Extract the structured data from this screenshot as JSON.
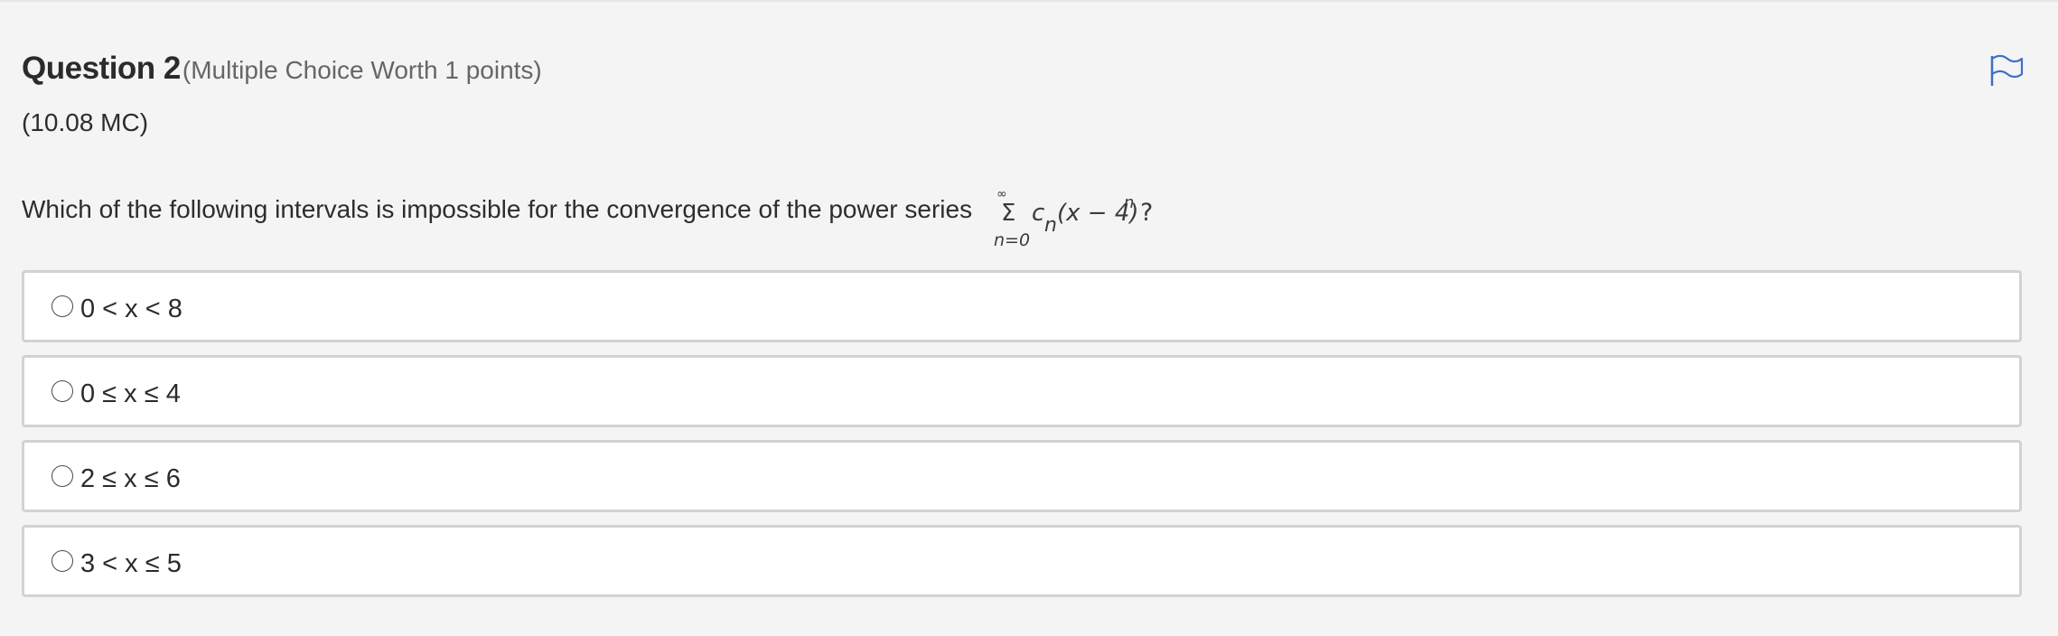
{
  "question": {
    "title": "Question 2",
    "worth": "(Multiple Choice Worth 1 points)",
    "code": "(10.08 MC)",
    "prompt": "Which of the following intervals is impossible for the convergence of the power series",
    "formula": {
      "sum_upper": "∞",
      "sigma": "Σ",
      "sum_lower": "n=0",
      "term_c": "c",
      "term_sub": "n",
      "term_body": "(x − 4)",
      "term_sup": "n",
      "end": "?"
    },
    "flag_icon": "flag-outline-icon",
    "accent_color": "#3f6fc8"
  },
  "choices": [
    {
      "label": "0 < x < 8",
      "selected": false
    },
    {
      "label": "0 ≤ x ≤ 4",
      "selected": false
    },
    {
      "label": "2 ≤ x ≤ 6",
      "selected": false
    },
    {
      "label": "3 < x ≤ 5",
      "selected": false
    }
  ]
}
